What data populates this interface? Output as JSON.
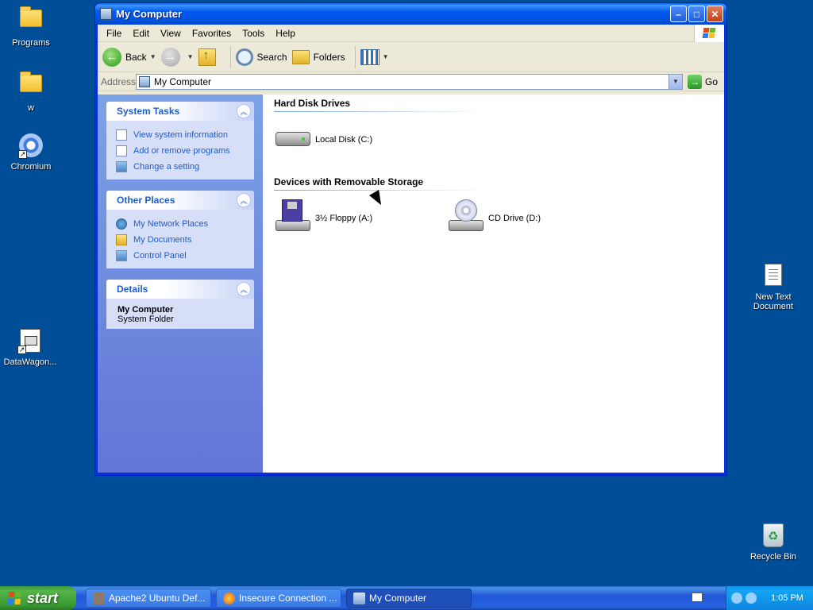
{
  "desktop": {
    "icons": [
      {
        "label": "Programs"
      },
      {
        "label": "w"
      },
      {
        "label": "Chromium"
      },
      {
        "label": "DataWagon..."
      },
      {
        "label": "New Text Document"
      },
      {
        "label": "Recycle Bin"
      }
    ]
  },
  "window": {
    "title": "My Computer",
    "menu": [
      "File",
      "Edit",
      "View",
      "Favorites",
      "Tools",
      "Help"
    ],
    "toolbar": {
      "back": "Back",
      "search": "Search",
      "folders": "Folders"
    },
    "address": {
      "label": "Address",
      "value": "My Computer",
      "go": "Go"
    },
    "taskpane": {
      "system_tasks": {
        "title": "System Tasks",
        "items": [
          "View system information",
          "Add or remove programs",
          "Change a setting"
        ]
      },
      "other_places": {
        "title": "Other Places",
        "items": [
          "My Network Places",
          "My Documents",
          "Control Panel"
        ]
      },
      "details": {
        "title": "Details",
        "name": "My Computer",
        "type": "System Folder"
      }
    },
    "groups": {
      "hard_disk": {
        "title": "Hard Disk Drives",
        "drives": [
          "Local Disk (C:)"
        ]
      },
      "removable": {
        "title": "Devices with Removable Storage",
        "drives": [
          "3½ Floppy (A:)",
          "CD Drive (D:)"
        ]
      }
    }
  },
  "taskbar": {
    "start": "start",
    "buttons": [
      "Apache2 Ubuntu Def...",
      "Insecure Connection ...",
      "My Computer"
    ],
    "clock": "1:05 PM"
  }
}
